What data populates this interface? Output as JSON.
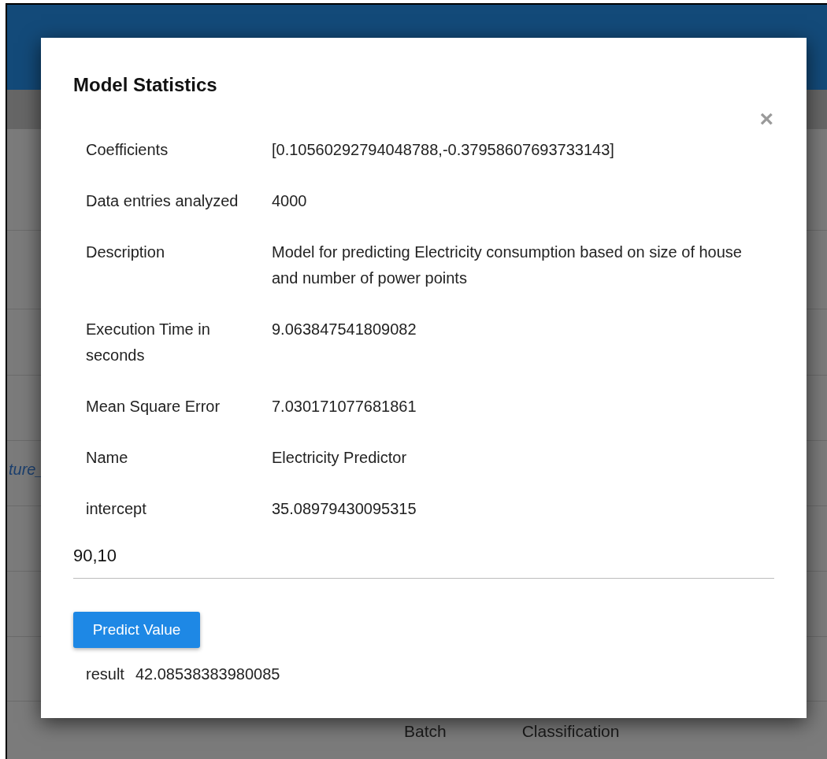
{
  "background": {
    "link_fragment": "ture_",
    "column_headers": [
      "Batch",
      "Classification"
    ]
  },
  "dialog": {
    "title": "Model Statistics",
    "close": "×",
    "stats": [
      {
        "label": "Coefficients",
        "value": "[0.10560292794048788,-0.37958607693733143]"
      },
      {
        "label": "Data entries analyzed",
        "value": "4000"
      },
      {
        "label": "Description",
        "value": "Model for predicting Electricity consumption based on size of house and number of power points"
      },
      {
        "label": "Execution Time in seconds",
        "value": "9.063847541809082"
      },
      {
        "label": "Mean Square Error",
        "value": "7.030171077681861"
      },
      {
        "label": "Name",
        "value": "Electricity Predictor"
      },
      {
        "label": "intercept",
        "value": "35.08979430095315"
      }
    ],
    "input": {
      "value": "90,10"
    },
    "button": "Predict Value",
    "result": {
      "label": "result",
      "value": "42.08538383980085"
    }
  }
}
